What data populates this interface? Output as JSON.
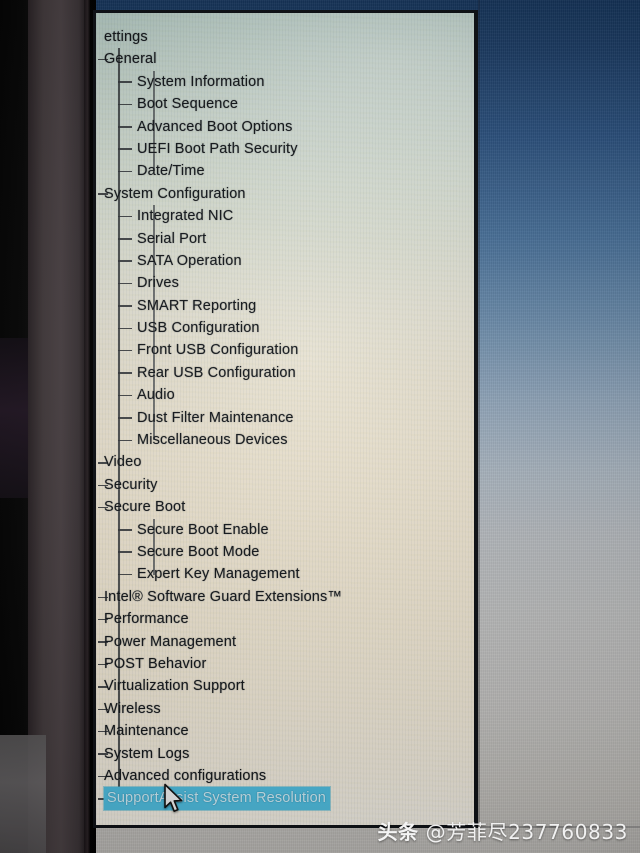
{
  "photo": {
    "watermark_brand": "头条",
    "watermark_handle": "@芳菲尽237760833"
  },
  "panel": {
    "root_label": "ettings",
    "root_full_label": "Settings",
    "selected_item": "SupportAssist System Resolution",
    "highlight_color": "#4fbee0",
    "text_color": "#14181c",
    "cursor_icon": "arrow-pointer-icon"
  },
  "tree": {
    "items": [
      {
        "label": "ettings",
        "level": 0,
        "selected": false
      },
      {
        "label": "General",
        "level": 0,
        "selected": false
      },
      {
        "label": "System Information",
        "level": 1,
        "selected": false
      },
      {
        "label": "Boot Sequence",
        "level": 1,
        "selected": false
      },
      {
        "label": "Advanced Boot Options",
        "level": 1,
        "selected": false
      },
      {
        "label": "UEFI Boot Path Security",
        "level": 1,
        "selected": false
      },
      {
        "label": "Date/Time",
        "level": 1,
        "selected": false
      },
      {
        "label": "System Configuration",
        "level": 0,
        "selected": false
      },
      {
        "label": "Integrated NIC",
        "level": 1,
        "selected": false
      },
      {
        "label": "Serial Port",
        "level": 1,
        "selected": false
      },
      {
        "label": "SATA Operation",
        "level": 1,
        "selected": false
      },
      {
        "label": "Drives",
        "level": 1,
        "selected": false
      },
      {
        "label": "SMART Reporting",
        "level": 1,
        "selected": false
      },
      {
        "label": "USB Configuration",
        "level": 1,
        "selected": false
      },
      {
        "label": "Front USB Configuration",
        "level": 1,
        "selected": false
      },
      {
        "label": "Rear USB Configuration",
        "level": 1,
        "selected": false
      },
      {
        "label": "Audio",
        "level": 1,
        "selected": false
      },
      {
        "label": "Dust Filter Maintenance",
        "level": 1,
        "selected": false
      },
      {
        "label": "Miscellaneous Devices",
        "level": 1,
        "selected": false
      },
      {
        "label": "Video",
        "level": 0,
        "selected": false
      },
      {
        "label": "Security",
        "level": 0,
        "selected": false
      },
      {
        "label": "Secure Boot",
        "level": 0,
        "selected": false
      },
      {
        "label": "Secure Boot Enable",
        "level": 1,
        "selected": false
      },
      {
        "label": "Secure Boot Mode",
        "level": 1,
        "selected": false
      },
      {
        "label": "Expert Key Management",
        "level": 1,
        "selected": false
      },
      {
        "label": "Intel® Software Guard Extensions™",
        "level": 0,
        "selected": false
      },
      {
        "label": "Performance",
        "level": 0,
        "selected": false
      },
      {
        "label": "Power Management",
        "level": 0,
        "selected": false
      },
      {
        "label": "POST Behavior",
        "level": 0,
        "selected": false
      },
      {
        "label": "Virtualization Support",
        "level": 0,
        "selected": false
      },
      {
        "label": "Wireless",
        "level": 0,
        "selected": false
      },
      {
        "label": "Maintenance",
        "level": 0,
        "selected": false
      },
      {
        "label": "System Logs",
        "level": 0,
        "selected": false
      },
      {
        "label": "Advanced configurations",
        "level": 0,
        "selected": false
      },
      {
        "label": "SupportAssist System Resolution",
        "level": 0,
        "selected": true
      }
    ]
  }
}
